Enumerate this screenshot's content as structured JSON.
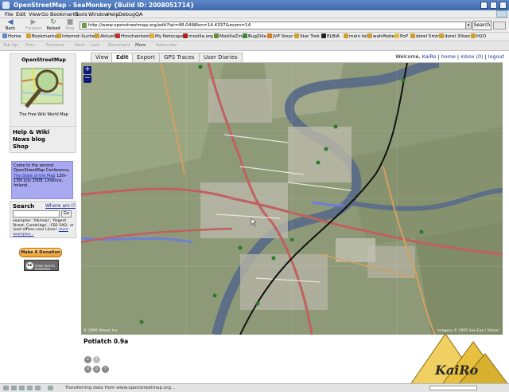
{
  "window": {
    "title": "OpenStreetMap - SeaMonkey {Build ID: 2008051714}"
  },
  "menu": [
    "File",
    "Edit",
    "View",
    "Go",
    "Bookmarks",
    "Tools",
    "Window",
    "Help",
    "Debug",
    "QA"
  ],
  "nav": {
    "back": "Back",
    "forward": "Forward",
    "reload": "Reload",
    "stop": "Stop",
    "url": "http://www.openstreetmap.org/edit?lat=48.0498lon=14.4337&zoom=14",
    "search_button": "Search"
  },
  "bookmarks": [
    "Home",
    "Bookmarks",
    "Internet-Suche",
    "Aktuell",
    "Hirschenhein",
    "My Netscape",
    "mozilla.org",
    "MozillaZine",
    "BugZilla",
    "JVP Steyr",
    "Star Trek",
    "ELBIA",
    "mein tele",
    "wahlfieber",
    "PoP",
    "dorel 5min",
    "dorel 30sec",
    "H2O"
  ],
  "tabs_toolbar": [
    "Tab Up",
    "Prev",
    "Previous",
    "Next",
    "Last",
    "Document",
    "More",
    "Subscribe"
  ],
  "sidebar": {
    "logo_title": "OpenStreetMap",
    "logo_subtitle": "The Free Wiki World Map",
    "links": [
      "Help & Wiki",
      "News blog",
      "Shop"
    ],
    "notice_prefix": "Come to the second OpenStreetMap Conference,",
    "notice_link": "The State of the Map",
    "notice_suffix": "12th-13th July 2008, Limerick, Ireland.",
    "search_title": "Search",
    "where_am_i": "Where am I?",
    "search_value": "",
    "go_label": "Go",
    "examples": "examples: 'Alkmaar', 'Regent Street, Cambridge', 'CB2 5AQ', or 'post offices near Lünen'",
    "more_examples": "more examples...",
    "donate": "Make A Donation",
    "license": "SOME RIGHTS RESERVED"
  },
  "maptabs": [
    "View",
    "Edit",
    "Export",
    "GPS Traces",
    "User Diaries"
  ],
  "active_tab": "Edit",
  "user": {
    "welcome": "Welcome,",
    "name": "KaiRo",
    "home": "home",
    "inbox": "inbox (0)",
    "logout": "logout"
  },
  "map": {
    "copyright": "© 2005 Yahoo! Inc.",
    "imagery": "Imagery © 2005 Sea Eye / Yahoo!",
    "zoom_in": "+",
    "zoom_out": "−"
  },
  "editor": {
    "name": "Potlatch 0.9a"
  },
  "watermark": {
    "name": "KaiRo"
  },
  "status": {
    "text": "Transferring data from www.openstreetmap.org..."
  },
  "colors": {
    "title_bar": "#4a76bb",
    "notice_bg": "#a9a9f2",
    "link": "#1a2f9a",
    "zoom_control": "#0d1a7a",
    "river": "#5d6f86"
  }
}
